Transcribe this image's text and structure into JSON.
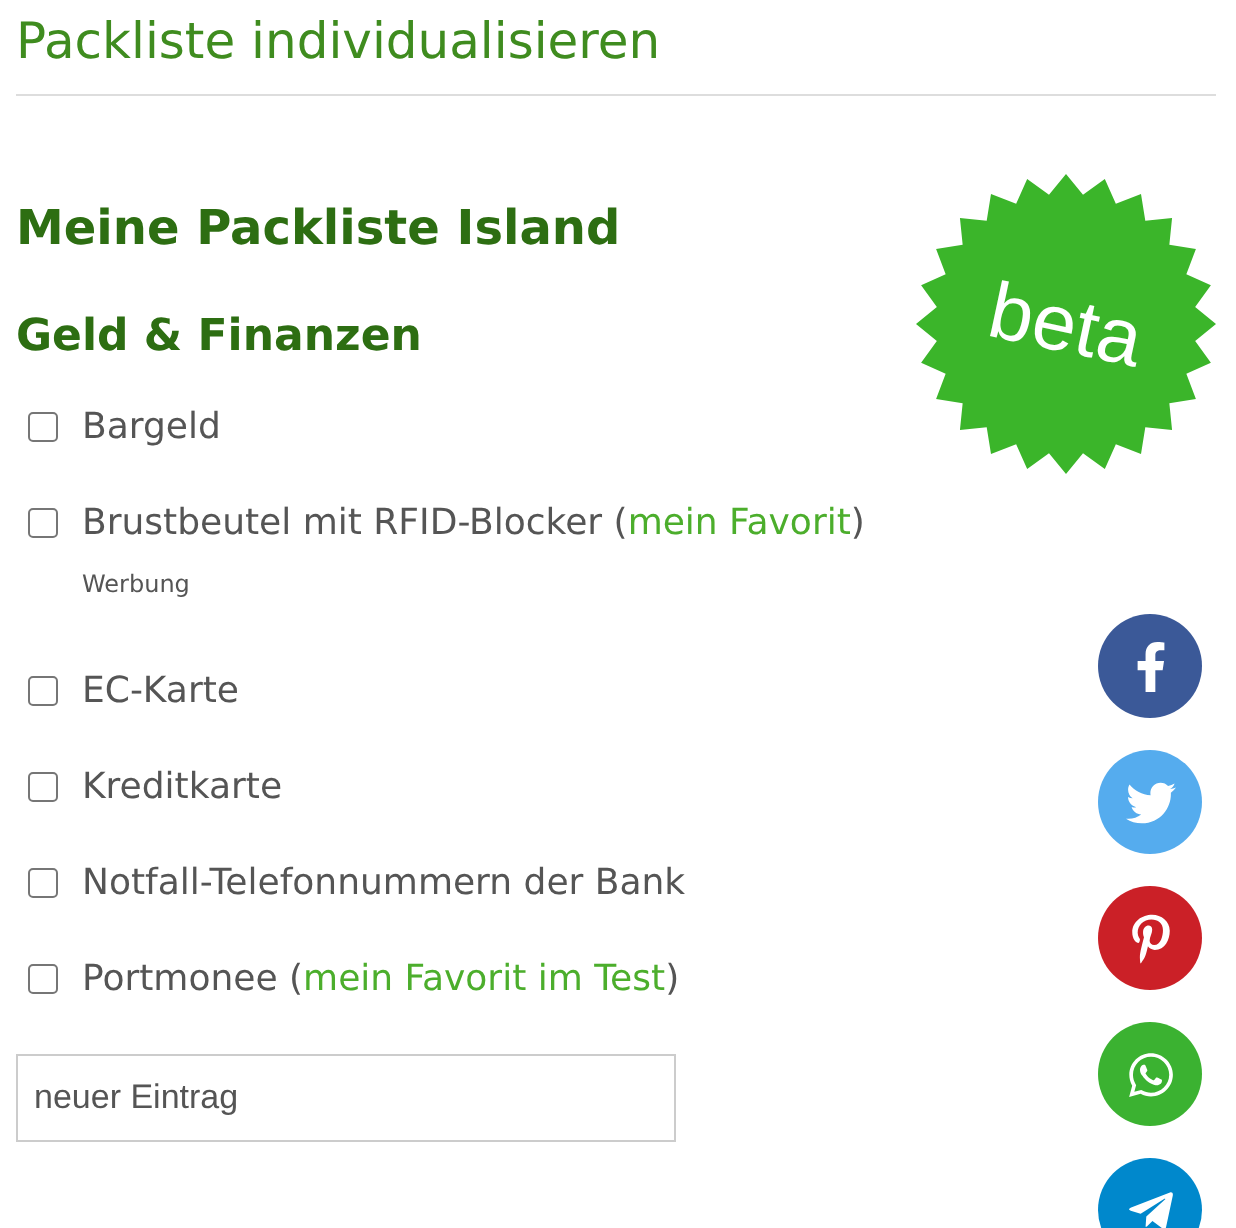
{
  "page_title": "Packliste individualisieren",
  "list_title": "Meine Packliste Island",
  "badge": "beta",
  "category": "Geld & Finanzen",
  "items": [
    {
      "label": "Bargeld",
      "checked": false
    },
    {
      "label": "Brustbeutel mit RFID-Blocker (",
      "link": "mein Favorit",
      "after": ")",
      "note": "Werbung",
      "checked": false
    },
    {
      "label": "EC-Karte",
      "checked": false
    },
    {
      "label": "Kreditkarte",
      "checked": false
    },
    {
      "label": "Notfall-Telefonnummern der Bank",
      "checked": false
    },
    {
      "label": "Portmonee (",
      "link": "mein Favorit im Test",
      "after": ")",
      "checked": false
    }
  ],
  "new_entry": {
    "placeholder": "neuer Eintrag"
  },
  "share": [
    {
      "kind": "facebook",
      "color": "#3b5998"
    },
    {
      "kind": "twitter",
      "color": "#55acee"
    },
    {
      "kind": "pinterest",
      "color": "#cb2027"
    },
    {
      "kind": "whatsapp",
      "color": "#3bb231"
    },
    {
      "kind": "telegram",
      "color": "#0088cc"
    }
  ]
}
